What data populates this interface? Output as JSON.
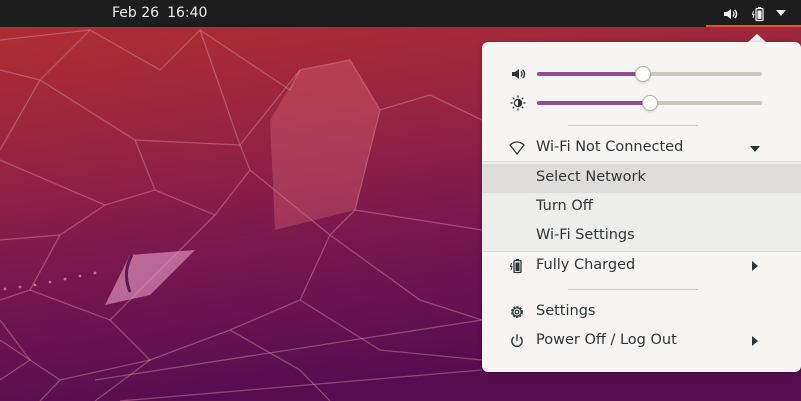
{
  "topbar": {
    "date": "Feb 26",
    "time": "16:40",
    "icons": [
      "speaker-icon",
      "battery-icon",
      "menu-arrow-icon"
    ]
  },
  "menu": {
    "volume": {
      "icon": "speaker-icon",
      "level": 0.47
    },
    "brightness": {
      "icon": "brightness-icon",
      "level": 0.5
    },
    "wifi": {
      "icon": "wifi-icon",
      "label": "Wi-Fi Not Connected",
      "submenu": [
        {
          "label": "Select Network"
        },
        {
          "label": "Turn Off"
        },
        {
          "label": "Wi-Fi Settings"
        }
      ]
    },
    "battery": {
      "icon": "battery-icon",
      "label": "Fully Charged"
    },
    "settings": {
      "icon": "gear-icon",
      "label": "Settings"
    },
    "power": {
      "icon": "power-icon",
      "label": "Power Off / Log Out"
    }
  },
  "colors": {
    "accent": "#924d8b",
    "topbar_underline": "#e95420",
    "wallpaper_top": "#b02f2f",
    "wallpaper_bottom": "#5d0f52"
  }
}
